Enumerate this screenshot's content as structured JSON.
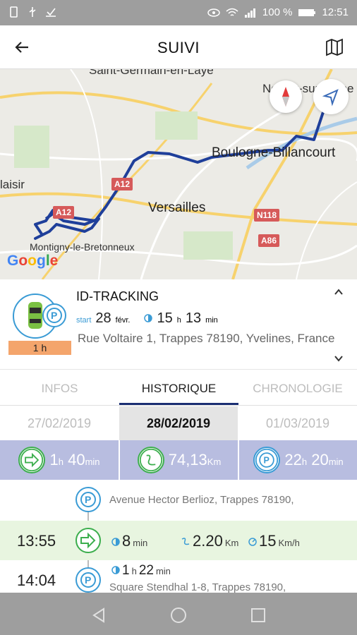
{
  "status": {
    "left_icons": [
      "phone-icon",
      "usb-icon",
      "checkbox-icon"
    ],
    "battery": "100 %",
    "time": "12:51"
  },
  "appbar": {
    "title": "SUIVI"
  },
  "map": {
    "labels": {
      "saint_germain": "Saint-Germain-en-Laye",
      "neuilly": "Neuilly-sur-Seine",
      "boulogne": "Boulogne-Billancourt",
      "plaisir": "laisir",
      "versailles": "Versailles",
      "montigny": "Montigny-le-Bretonneux"
    },
    "shields": {
      "a12": "A12",
      "a12b": "A12",
      "n118": "N118",
      "a86": "A86"
    },
    "google": "Google"
  },
  "vehicle": {
    "name": "ID-TRACKING",
    "duration": "1 h",
    "start_prefix": "start",
    "date": "28",
    "month": "févr.",
    "hours": "15",
    "hours_unit": "h",
    "minutes": "13",
    "minutes_unit": "min",
    "address": "Rue Voltaire 1, Trappes 78190, Yvelines, France"
  },
  "tabs": [
    "INFOS",
    "HISTORIQUE",
    "CHRONOLOGIE"
  ],
  "dates": [
    "27/02/2019",
    "28/02/2019",
    "01/03/2019"
  ],
  "stats": {
    "drive": {
      "h": "1",
      "h_unit": "h",
      "m": "40",
      "m_unit": "min"
    },
    "distance": {
      "v": "74,13",
      "unit": "Km"
    },
    "parking": {
      "h": "22",
      "h_unit": "h",
      "m": "20",
      "m_unit": "min"
    }
  },
  "timeline": {
    "row1_address": "Avenue Hector Berlioz, Trappes 78190,",
    "row2": {
      "time": "13:55",
      "duration": "8",
      "duration_unit": "min",
      "distance": "2.20",
      "distance_unit": "Km",
      "speed": "15",
      "speed_unit": "Km/h"
    },
    "row3": {
      "time": "14:04",
      "h": "1",
      "h_unit": "h",
      "m": "22",
      "m_unit": "min",
      "address": "Square Stendhal 1-8, Trappes 78190,"
    }
  },
  "colors": {
    "accent": "#1b2f73",
    "route": "#1f3f9a",
    "green": "#3cae4d",
    "blue": "#3a9bd5",
    "orange": "#f4a56c"
  }
}
